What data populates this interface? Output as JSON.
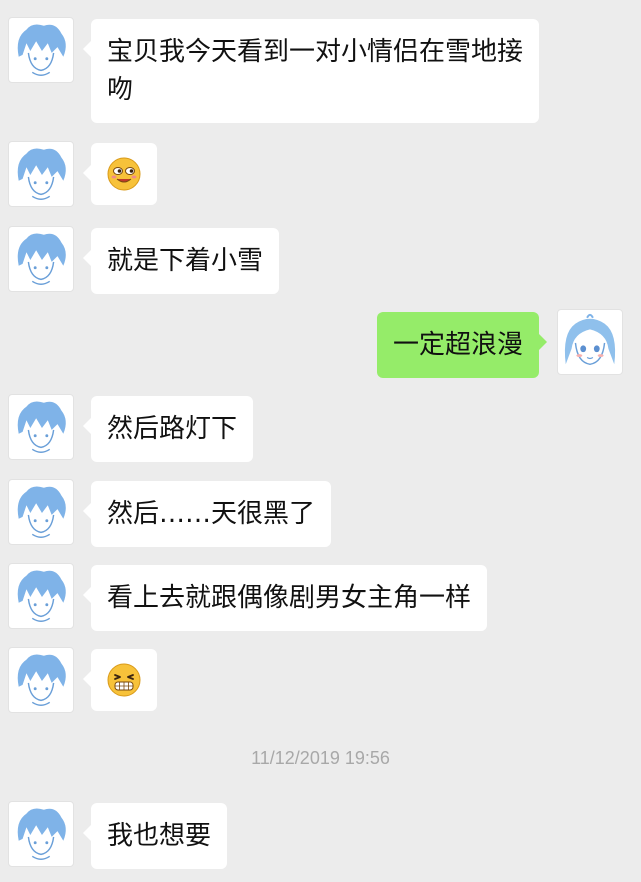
{
  "conversation": {
    "messages": [
      {
        "from": "them",
        "text": "宝贝我今天看到一对小情侣在雪地接吻"
      },
      {
        "from": "them",
        "emoji": "smirk-face-icon"
      },
      {
        "from": "them",
        "text": "就是下着小雪"
      },
      {
        "from": "me",
        "text": "一定超浪漫"
      },
      {
        "from": "them",
        "text": "然后路灯下"
      },
      {
        "from": "them",
        "text": "然后……天很黑了"
      },
      {
        "from": "them",
        "text": "看上去就跟偶像剧男女主角一样"
      },
      {
        "from": "them",
        "emoji": "grimace-face-icon"
      },
      {
        "from": "them",
        "text": "我也想要"
      }
    ],
    "timestamp": "11/12/2019 19:56"
  },
  "colors": {
    "background": "#ececec",
    "received_bubble": "#ffffff",
    "sent_bubble": "#95ec69",
    "timestamp_text": "#a8a8a8",
    "avatar_hair": "#7fb3e8"
  }
}
